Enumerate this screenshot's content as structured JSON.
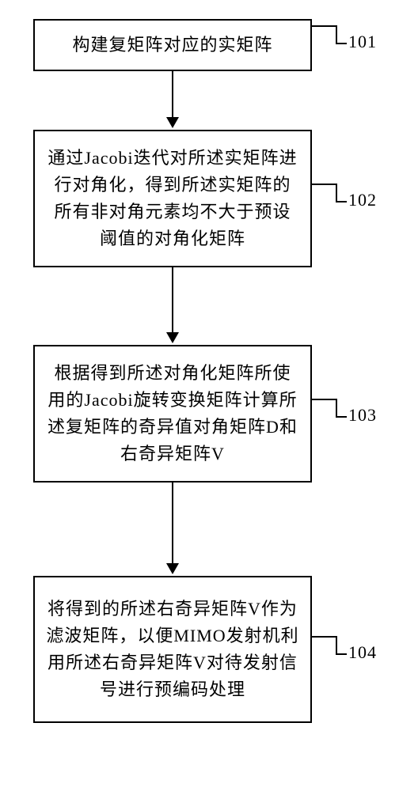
{
  "steps": [
    {
      "label": "101",
      "text": "构建复矩阵对应的实矩阵"
    },
    {
      "label": "102",
      "text": "通过Jacobi迭代对所述实矩阵进行对角化，得到所述实矩阵的所有非对角元素均不大于预设阈值的对角化矩阵"
    },
    {
      "label": "103",
      "text": "根据得到所述对角化矩阵所使用的Jacobi旋转变换矩阵计算所述复矩阵的奇异值对角矩阵D和右奇异矩阵V"
    },
    {
      "label": "104",
      "text": "将得到的所述右奇异矩阵V作为滤波矩阵，以便MIMO发射机利用所述右奇异矩阵V对待发射信号进行预编码处理"
    }
  ]
}
